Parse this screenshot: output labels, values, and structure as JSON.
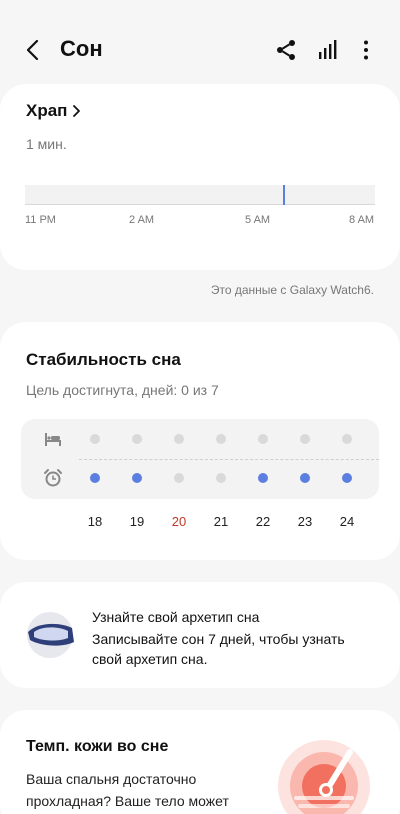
{
  "header": {
    "title": "Сон",
    "icons": [
      "back-arrow-icon",
      "share-icon",
      "signal-bars-icon",
      "more-vert-icon"
    ]
  },
  "snore": {
    "title": "Храп",
    "duration": "1 мин.",
    "ticks": [
      "11 PM",
      "2 AM",
      "5 AM",
      "8 AM"
    ],
    "source_note": "Это данные с Galaxy Watch6.",
    "accent": "#5b7fe0"
  },
  "stability": {
    "title": "Стабильность сна",
    "goal_text": "Цель достигнута, дней: 0 из 7",
    "days": [
      "18",
      "19",
      "20",
      "21",
      "22",
      "23",
      "24"
    ],
    "bedtime_row": [
      "gray",
      "gray",
      "gray",
      "gray",
      "gray",
      "gray",
      "gray"
    ],
    "wake_row": [
      "blue",
      "blue",
      "gray",
      "gray",
      "blue",
      "blue",
      "blue"
    ],
    "colors": {
      "blue": "#5b7fe0",
      "gray": "#d9d9d9",
      "weekend": "#c0392b"
    }
  },
  "archetype": {
    "heading": "Узнайте свой архетип сна",
    "body": "Записывайте сон 7 дней, чтобы узнать свой архетип сна."
  },
  "skin_temp": {
    "title": "Темп. кожи во сне",
    "body": "Ваша спальня достаточно прохладная? Ваше тело может"
  }
}
